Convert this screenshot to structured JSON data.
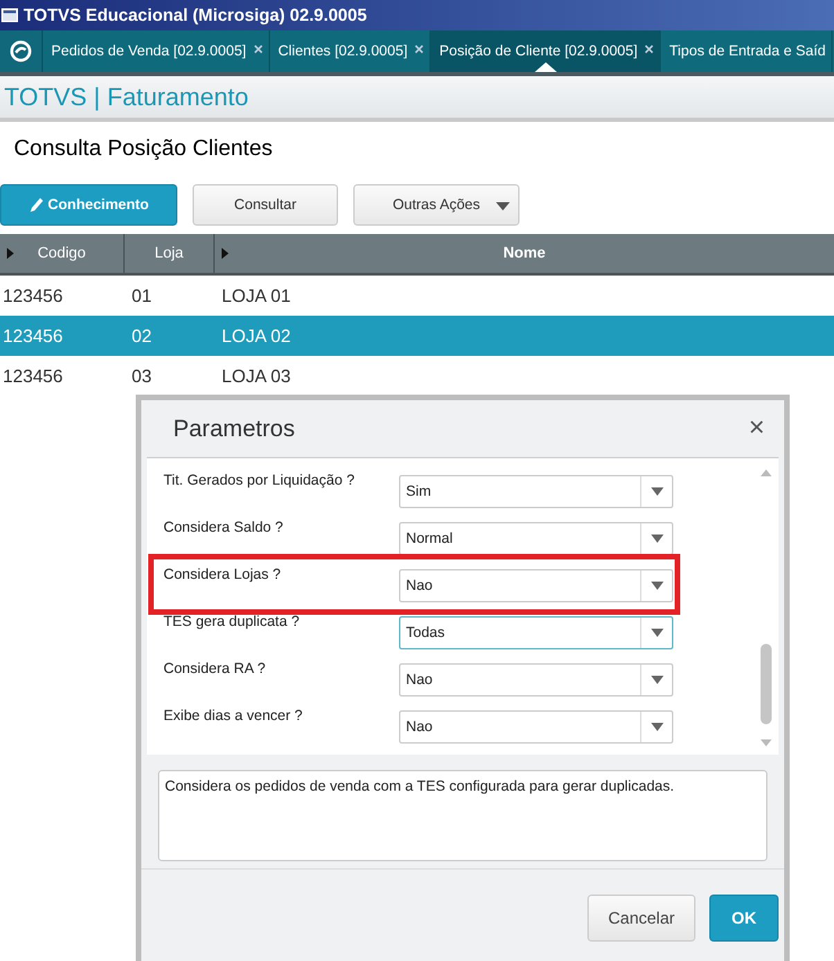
{
  "window": {
    "title": "TOTVS Educacional (Microsiga) 02.9.0005"
  },
  "tabs": [
    {
      "label": "Pedidos de Venda [02.9.0005]",
      "selected": false,
      "closable": true
    },
    {
      "label": "Clientes [02.9.0005]",
      "selected": false,
      "closable": true
    },
    {
      "label": "Posição de Cliente [02.9.0005]",
      "selected": true,
      "closable": true
    },
    {
      "label": "Tipos de Entrada e Saíd",
      "selected": false,
      "closable": false
    }
  ],
  "module_title": "TOTVS | Faturamento",
  "page_title": "Consulta Posição Clientes",
  "toolbar": [
    {
      "label": "Conhecimento",
      "kind": "primary"
    },
    {
      "label": "Consultar",
      "kind": "plain"
    },
    {
      "label": "Outras Ações",
      "kind": "menu"
    }
  ],
  "table": {
    "columns": [
      {
        "label": "Codigo",
        "sortable": true
      },
      {
        "label": "Loja",
        "sortable": false
      },
      {
        "label": "Nome",
        "sortable": true
      }
    ],
    "rows": [
      {
        "cells": [
          "123456",
          "01",
          "LOJA 01"
        ],
        "selected": false
      },
      {
        "cells": [
          "123456",
          "02",
          "LOJA 02"
        ],
        "selected": true
      },
      {
        "cells": [
          "123456",
          "03",
          "LOJA 03"
        ],
        "selected": false
      }
    ]
  },
  "dialog": {
    "title": "Parametros",
    "close": "×",
    "params": [
      {
        "label": "Tit. Gerados por Liquidação ?",
        "value": "Sim",
        "focused": false,
        "highlighted": false
      },
      {
        "label": "Considera Saldo ?",
        "value": "Normal",
        "focused": false,
        "highlighted": false
      },
      {
        "label": "Considera Lojas ?",
        "value": "Nao",
        "focused": false,
        "highlighted": true
      },
      {
        "label": "TES gera duplicata ?",
        "value": "Todas",
        "focused": true,
        "highlighted": false
      },
      {
        "label": "Considera RA ?",
        "value": "Nao",
        "focused": false,
        "highlighted": false
      },
      {
        "label": "Exibe dias a vencer ?",
        "value": "Nao",
        "focused": false,
        "highlighted": false
      }
    ],
    "description": "Considera os pedidos de venda com a TES configurada para gerar duplicadas.",
    "buttons": [
      {
        "label": "Cancelar",
        "kind": "plain"
      },
      {
        "label": "OK",
        "kind": "primary"
      }
    ]
  }
}
